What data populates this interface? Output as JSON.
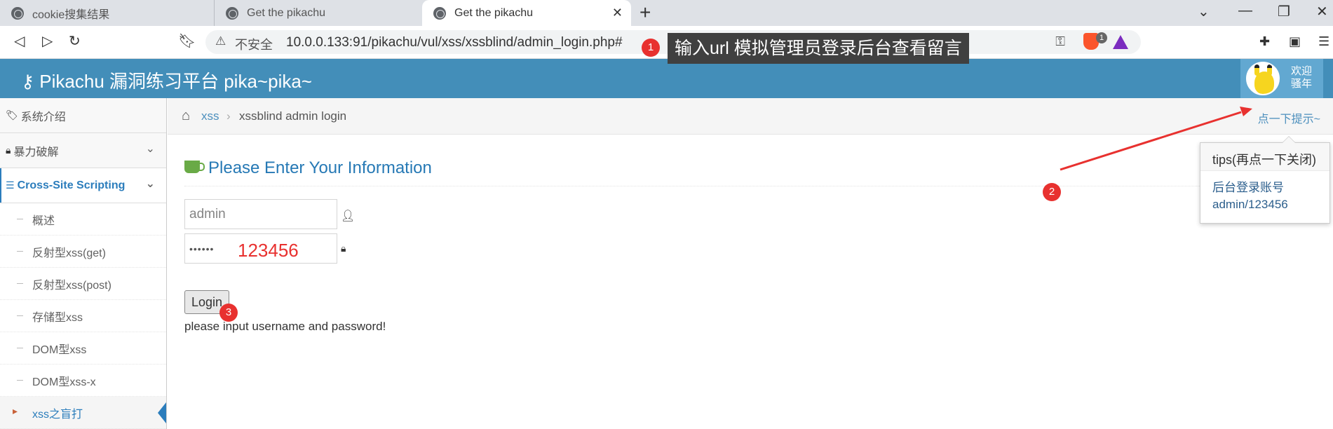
{
  "browser": {
    "tabs": [
      {
        "label": "cookie搜集结果"
      },
      {
        "label": "Get the pikachu"
      },
      {
        "label": "Get the pikachu"
      }
    ],
    "new_tab_glyph": "+",
    "window_controls": {
      "tab_list": "⌄",
      "minimize": "—",
      "restore": "❐",
      "close": "✕"
    },
    "security_label": "不安全",
    "url": "10.0.0.133:91/pikachu/vul/xss/xssblind/admin_login.php#",
    "extension_badge": "1"
  },
  "annotations": {
    "step1": "1",
    "step2": "2",
    "step3": "3",
    "note": "输入url 模拟管理员登录后台查看留言",
    "colors": {
      "marker": "#e8312f",
      "arrow": "#e8312f"
    }
  },
  "header": {
    "title": "Pikachu 漏洞练习平台 pika~pika~",
    "user_line1": "欢迎",
    "user_line2": "骚年",
    "color": "#438eb9"
  },
  "sidebar": {
    "items": [
      {
        "label": "系统介绍",
        "icon": "tags-icon"
      },
      {
        "label": "暴力破解",
        "icon": "lock-icon"
      },
      {
        "label": "Cross-Site Scripting",
        "icon": "list-icon"
      }
    ],
    "subitems": [
      {
        "label": "概述"
      },
      {
        "label": "反射型xss(get)"
      },
      {
        "label": "反射型xss(post)"
      },
      {
        "label": "存储型xss"
      },
      {
        "label": "DOM型xss"
      },
      {
        "label": "DOM型xss-x"
      },
      {
        "label": "xss之盲打"
      }
    ]
  },
  "breadcrumb": {
    "parent": "xss",
    "current": "xssblind admin login",
    "tip_link": "点一下提示~"
  },
  "main": {
    "title": "Please Enter Your Information",
    "username_value": "admin",
    "password_mask": "••••••",
    "password_overlay": "123456",
    "login_label": "Login",
    "message": "please input username and password!"
  },
  "popover": {
    "title": "tips(再点一下关闭)",
    "line1": "后台登录账号",
    "line2": "admin/123456"
  }
}
